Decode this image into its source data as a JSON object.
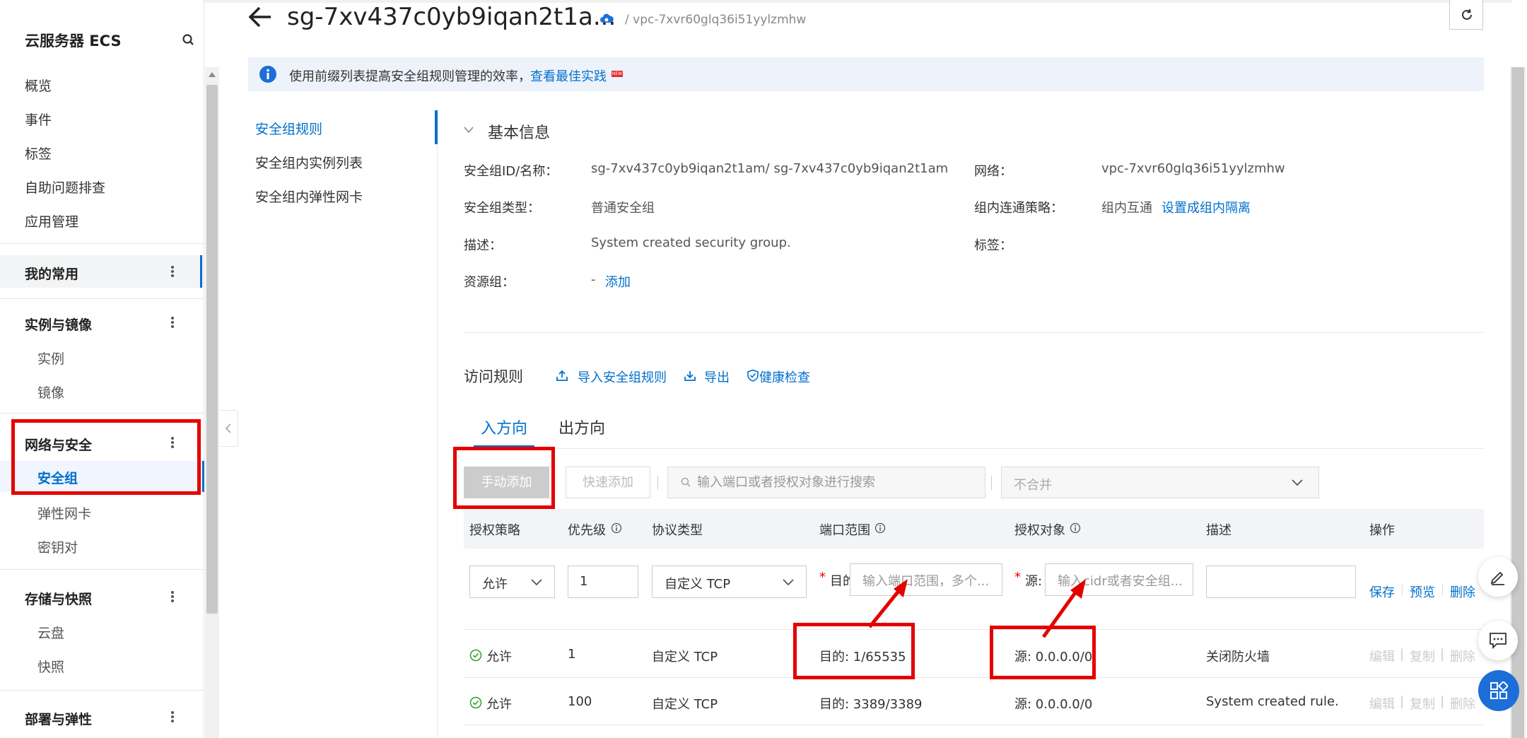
{
  "sidebar": {
    "title": "云服务器 ECS",
    "top_items": [
      "概览",
      "事件",
      "标签",
      "自助问题排查",
      "应用管理"
    ],
    "groups": {
      "favorites": "我的常用",
      "instances": {
        "label": "实例与镜像",
        "items": [
          "实例",
          "镜像"
        ]
      },
      "network": {
        "label": "网络与安全",
        "items": [
          "安全组",
          "弹性网卡",
          "密钥对"
        ]
      },
      "storage": {
        "label": "存储与快照",
        "items": [
          "云盘",
          "快照"
        ]
      },
      "deploy": "部署与弹性"
    }
  },
  "header": {
    "title": "sg-7xv437c0yb9iqan2t1a...",
    "breadcrumb": "/ vpc-7xvr60glq36i51yylzmhw"
  },
  "info_bar": {
    "text": "使用前缀列表提高安全组规则管理的效率，",
    "link": "查看最佳实践",
    "badge": "NEW"
  },
  "sub_nav": [
    "安全组规则",
    "安全组内实例列表",
    "安全组内弹性网卡"
  ],
  "basic_info": {
    "title": "基本信息",
    "id_label": "安全组ID/名称：",
    "id_value": "sg-7xv437c0yb9iqan2t1am/ sg-7xv437c0yb9iqan2t1am",
    "type_label": "安全组类型：",
    "type_value": "普通安全组",
    "desc_label": "描述：",
    "desc_value": "System created security group.",
    "rg_label": "资源组：",
    "rg_value": "-",
    "rg_link": "添加",
    "net_label": "网络：",
    "net_value": "vpc-7xvr60glq36i51yylzmhw",
    "policy_label": "组内连通策略：",
    "policy_value": "组内互通",
    "policy_link": "设置成组内隔离",
    "tag_label": "标签："
  },
  "rules": {
    "title": "访问规则",
    "import": "导入安全组规则",
    "export": "导出",
    "health": "健康检查",
    "tab_in": "入方向",
    "tab_out": "出方向",
    "btn_manual": "手动添加",
    "btn_quick": "快速添加",
    "search_placeholder": "输入端口或者授权对象进行搜索",
    "merge": "不合并",
    "columns": [
      "授权策略",
      "优先级",
      "协议类型",
      "端口范围",
      "授权对象",
      "描述",
      "操作"
    ],
    "edit_row": {
      "policy": "允许",
      "priority": "1",
      "protocol": "自定义 TCP",
      "port_prefix": "目的",
      "port_placeholder": "输入端口范围，多个...",
      "src_prefix": "源:",
      "src_placeholder": "输入cidr或者安全组...",
      "actions": [
        "保存",
        "预览",
        "删除"
      ]
    },
    "rows": [
      {
        "policy": "允许",
        "priority": "1",
        "protocol": "自定义 TCP",
        "port": "目的: 1/65535",
        "source": "源: 0.0.0.0/0",
        "desc": "关闭防火墙",
        "actions": [
          "编辑",
          "复制",
          "删除"
        ]
      },
      {
        "policy": "允许",
        "priority": "100",
        "protocol": "自定义 TCP",
        "port": "目的: 3389/3389",
        "source": "源: 0.0.0.0/0",
        "desc": "System created rule.",
        "actions": [
          "编辑",
          "复制",
          "删除"
        ]
      }
    ]
  },
  "colors": {
    "accent": "#0070cc",
    "highlight": "#e50000",
    "brand": "#ff6a00"
  }
}
